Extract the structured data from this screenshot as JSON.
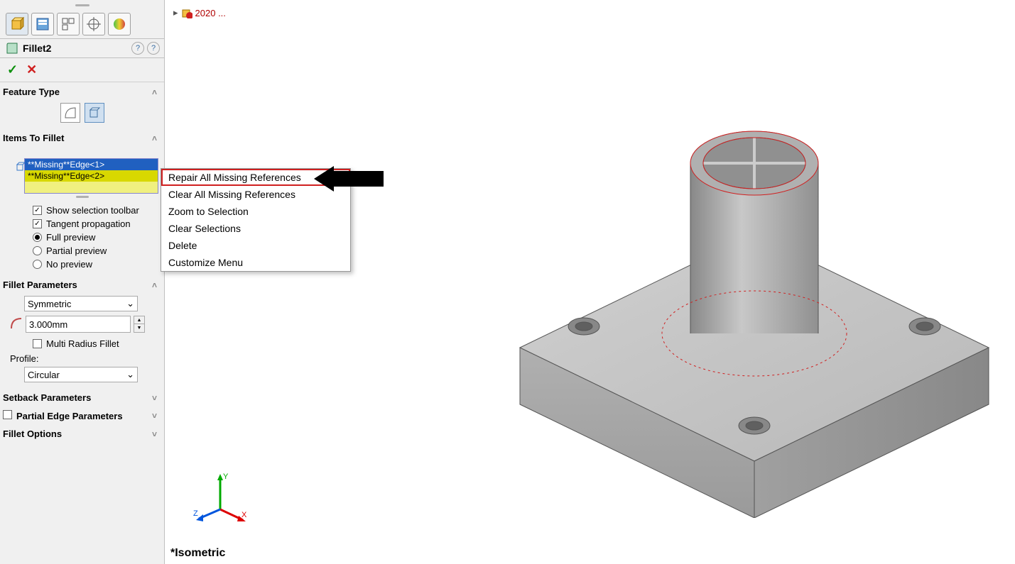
{
  "crumb": "2020 ...",
  "feature_name": "Fillet2",
  "sections": {
    "feature_type": "Feature Type",
    "items_to_fillet": "Items To Fillet",
    "fillet_parameters": "Fillet Parameters",
    "setback_parameters": "Setback Parameters",
    "partial_edge_parameters": "Partial Edge Parameters",
    "fillet_options": "Fillet Options"
  },
  "items": [
    "**Missing**Edge<1>",
    "**Missing**Edge<2>"
  ],
  "options": {
    "show_sel_toolbar": "Show selection toolbar",
    "tangent_prop": "Tangent propagation",
    "full_preview": "Full preview",
    "partial_preview": "Partial preview",
    "no_preview": "No preview"
  },
  "params": {
    "symmetry": "Symmetric",
    "radius": "3.000mm",
    "multi_radius": "Multi Radius Fillet",
    "profile_label": "Profile:",
    "profile": "Circular"
  },
  "context_menu": [
    "Repair All Missing References",
    "Clear All Missing References",
    "Zoom to Selection",
    "Clear Selections",
    "Delete",
    "Customize Menu"
  ],
  "view_label": "*Isometric",
  "triad": {
    "x": "X",
    "y": "Y",
    "z": "Z"
  },
  "chev_collapse": "˄",
  "chev_expand": "˅",
  "dd_arrow": "⌄"
}
